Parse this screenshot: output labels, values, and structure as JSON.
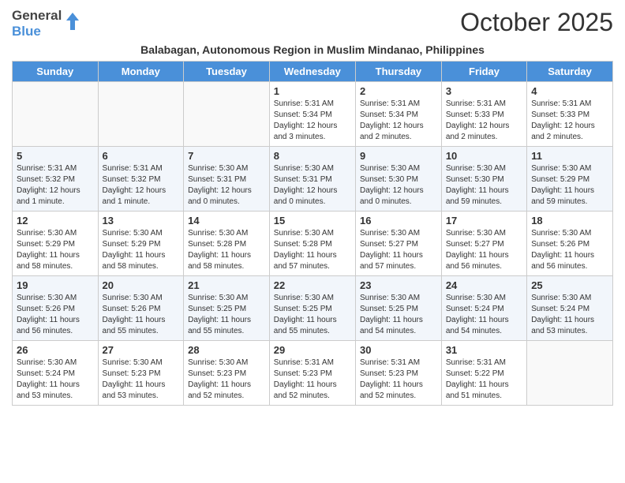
{
  "logo": {
    "line1": "General",
    "line2": "Blue"
  },
  "title": "October 2025",
  "subtitle": "Balabagan, Autonomous Region in Muslim Mindanao, Philippines",
  "days_of_week": [
    "Sunday",
    "Monday",
    "Tuesday",
    "Wednesday",
    "Thursday",
    "Friday",
    "Saturday"
  ],
  "weeks": [
    [
      {
        "day": "",
        "info": ""
      },
      {
        "day": "",
        "info": ""
      },
      {
        "day": "",
        "info": ""
      },
      {
        "day": "1",
        "info": "Sunrise: 5:31 AM\nSunset: 5:34 PM\nDaylight: 12 hours and 3 minutes."
      },
      {
        "day": "2",
        "info": "Sunrise: 5:31 AM\nSunset: 5:34 PM\nDaylight: 12 hours and 2 minutes."
      },
      {
        "day": "3",
        "info": "Sunrise: 5:31 AM\nSunset: 5:33 PM\nDaylight: 12 hours and 2 minutes."
      },
      {
        "day": "4",
        "info": "Sunrise: 5:31 AM\nSunset: 5:33 PM\nDaylight: 12 hours and 2 minutes."
      }
    ],
    [
      {
        "day": "5",
        "info": "Sunrise: 5:31 AM\nSunset: 5:32 PM\nDaylight: 12 hours and 1 minute."
      },
      {
        "day": "6",
        "info": "Sunrise: 5:31 AM\nSunset: 5:32 PM\nDaylight: 12 hours and 1 minute."
      },
      {
        "day": "7",
        "info": "Sunrise: 5:30 AM\nSunset: 5:31 PM\nDaylight: 12 hours and 0 minutes."
      },
      {
        "day": "8",
        "info": "Sunrise: 5:30 AM\nSunset: 5:31 PM\nDaylight: 12 hours and 0 minutes."
      },
      {
        "day": "9",
        "info": "Sunrise: 5:30 AM\nSunset: 5:30 PM\nDaylight: 12 hours and 0 minutes."
      },
      {
        "day": "10",
        "info": "Sunrise: 5:30 AM\nSunset: 5:30 PM\nDaylight: 11 hours and 59 minutes."
      },
      {
        "day": "11",
        "info": "Sunrise: 5:30 AM\nSunset: 5:29 PM\nDaylight: 11 hours and 59 minutes."
      }
    ],
    [
      {
        "day": "12",
        "info": "Sunrise: 5:30 AM\nSunset: 5:29 PM\nDaylight: 11 hours and 58 minutes."
      },
      {
        "day": "13",
        "info": "Sunrise: 5:30 AM\nSunset: 5:29 PM\nDaylight: 11 hours and 58 minutes."
      },
      {
        "day": "14",
        "info": "Sunrise: 5:30 AM\nSunset: 5:28 PM\nDaylight: 11 hours and 58 minutes."
      },
      {
        "day": "15",
        "info": "Sunrise: 5:30 AM\nSunset: 5:28 PM\nDaylight: 11 hours and 57 minutes."
      },
      {
        "day": "16",
        "info": "Sunrise: 5:30 AM\nSunset: 5:27 PM\nDaylight: 11 hours and 57 minutes."
      },
      {
        "day": "17",
        "info": "Sunrise: 5:30 AM\nSunset: 5:27 PM\nDaylight: 11 hours and 56 minutes."
      },
      {
        "day": "18",
        "info": "Sunrise: 5:30 AM\nSunset: 5:26 PM\nDaylight: 11 hours and 56 minutes."
      }
    ],
    [
      {
        "day": "19",
        "info": "Sunrise: 5:30 AM\nSunset: 5:26 PM\nDaylight: 11 hours and 56 minutes."
      },
      {
        "day": "20",
        "info": "Sunrise: 5:30 AM\nSunset: 5:26 PM\nDaylight: 11 hours and 55 minutes."
      },
      {
        "day": "21",
        "info": "Sunrise: 5:30 AM\nSunset: 5:25 PM\nDaylight: 11 hours and 55 minutes."
      },
      {
        "day": "22",
        "info": "Sunrise: 5:30 AM\nSunset: 5:25 PM\nDaylight: 11 hours and 55 minutes."
      },
      {
        "day": "23",
        "info": "Sunrise: 5:30 AM\nSunset: 5:25 PM\nDaylight: 11 hours and 54 minutes."
      },
      {
        "day": "24",
        "info": "Sunrise: 5:30 AM\nSunset: 5:24 PM\nDaylight: 11 hours and 54 minutes."
      },
      {
        "day": "25",
        "info": "Sunrise: 5:30 AM\nSunset: 5:24 PM\nDaylight: 11 hours and 53 minutes."
      }
    ],
    [
      {
        "day": "26",
        "info": "Sunrise: 5:30 AM\nSunset: 5:24 PM\nDaylight: 11 hours and 53 minutes."
      },
      {
        "day": "27",
        "info": "Sunrise: 5:30 AM\nSunset: 5:23 PM\nDaylight: 11 hours and 53 minutes."
      },
      {
        "day": "28",
        "info": "Sunrise: 5:30 AM\nSunset: 5:23 PM\nDaylight: 11 hours and 52 minutes."
      },
      {
        "day": "29",
        "info": "Sunrise: 5:31 AM\nSunset: 5:23 PM\nDaylight: 11 hours and 52 minutes."
      },
      {
        "day": "30",
        "info": "Sunrise: 5:31 AM\nSunset: 5:23 PM\nDaylight: 11 hours and 52 minutes."
      },
      {
        "day": "31",
        "info": "Sunrise: 5:31 AM\nSunset: 5:22 PM\nDaylight: 11 hours and 51 minutes."
      },
      {
        "day": "",
        "info": ""
      }
    ]
  ],
  "colors": {
    "header_bg": "#4a90d9",
    "header_text": "#ffffff",
    "alt_row": "#f2f6fb"
  }
}
